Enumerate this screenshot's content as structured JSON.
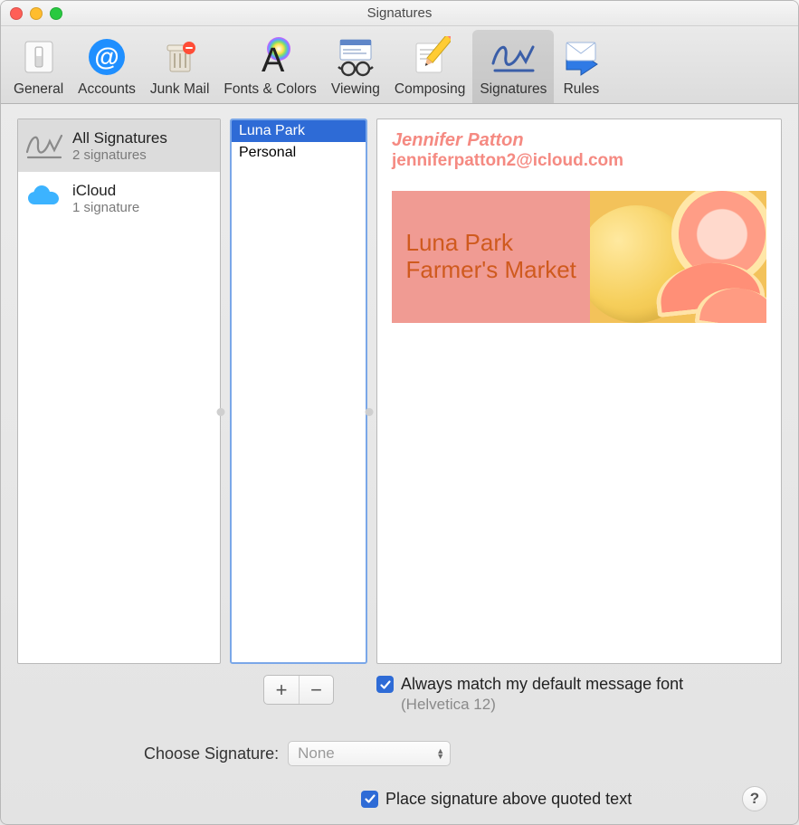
{
  "window": {
    "title": "Signatures"
  },
  "toolbar": {
    "tabs": [
      {
        "label": "General"
      },
      {
        "label": "Accounts"
      },
      {
        "label": "Junk Mail"
      },
      {
        "label": "Fonts & Colors"
      },
      {
        "label": "Viewing"
      },
      {
        "label": "Composing"
      },
      {
        "label": "Signatures"
      },
      {
        "label": "Rules"
      }
    ]
  },
  "accounts": [
    {
      "title": "All Signatures",
      "subtitle": "2 signatures"
    },
    {
      "title": "iCloud",
      "subtitle": "1 signature"
    }
  ],
  "signatures": [
    {
      "name": "Luna Park"
    },
    {
      "name": "Personal"
    }
  ],
  "preview": {
    "name": "Jennifer Patton",
    "email": "jenniferpatton2@icloud.com",
    "banner_line1": "Luna Park",
    "banner_line2": "Farmer's Market"
  },
  "options": {
    "match_font_label": "Always match my default message font",
    "match_font_detail": "(Helvetica 12)",
    "choose_label": "Choose Signature:",
    "choose_value": "None",
    "place_above_label": "Place signature above quoted text"
  },
  "buttons": {
    "add": "+",
    "remove": "−",
    "help": "?"
  }
}
